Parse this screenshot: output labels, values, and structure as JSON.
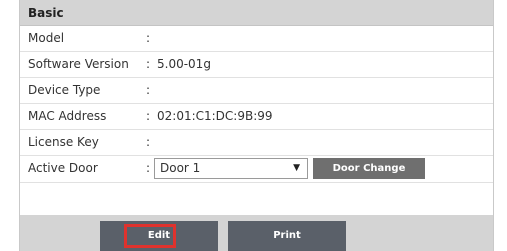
{
  "section": {
    "title": "Basic"
  },
  "rows": [
    {
      "label": "Model",
      "colon": ":",
      "value": ""
    },
    {
      "label": "Software Version",
      "colon": ":",
      "value": "5.00-01g"
    },
    {
      "label": "Device Type",
      "colon": ":",
      "value": ""
    },
    {
      "label": "MAC Address",
      "colon": ":",
      "value": "02:01:C1:DC:9B:99"
    },
    {
      "label": "License Key",
      "colon": ":",
      "value": ""
    }
  ],
  "active_door": {
    "label": "Active Door",
    "colon": ":",
    "selected": "Door 1",
    "dropdown_icon": "chevron-down-icon",
    "change_button": "Door Change"
  },
  "buttons": {
    "edit": "Edit",
    "print": "Print"
  },
  "colors": {
    "header_bg": "#d4d4d4",
    "button_bg": "#5a6069",
    "highlight": "#e0322d"
  }
}
